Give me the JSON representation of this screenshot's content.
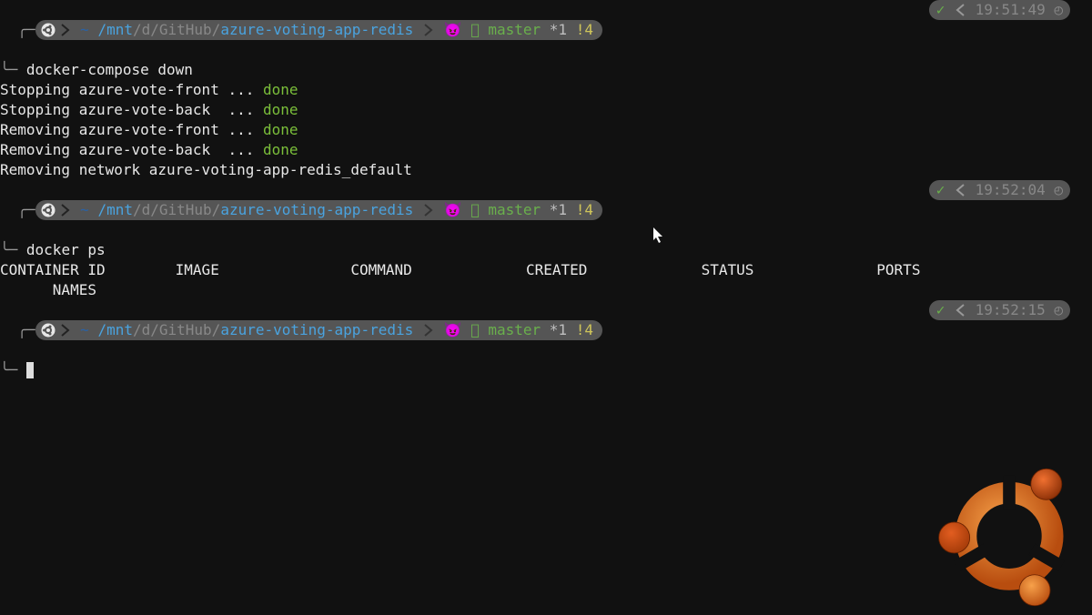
{
  "prompts": [
    {
      "path1": "/mnt",
      "path2": "/d/",
      "path3": "GitHub",
      "path4": "/",
      "repo": "azure-voting-app-redis",
      "branch": "master",
      "star": "*1",
      "bang": "!4",
      "time": "19:51:49",
      "command": "docker-compose down"
    },
    {
      "path1": "/mnt",
      "path2": "/d/",
      "path3": "GitHub",
      "path4": "/",
      "repo": "azure-voting-app-redis",
      "branch": "master",
      "star": "*1",
      "bang": "!4",
      "time": "19:52:04",
      "command": "docker ps"
    },
    {
      "path1": "/mnt",
      "path2": "/d/",
      "path3": "GitHub",
      "path4": "/",
      "repo": "azure-voting-app-redis",
      "branch": "master",
      "star": "*1",
      "bang": "!4",
      "time": "19:52:15",
      "command": ""
    }
  ],
  "branch_icon": "😈 ",
  "output1": [
    {
      "pre": "Stopping azure-vote-front ... ",
      "status": "done"
    },
    {
      "pre": "Stopping azure-vote-back  ... ",
      "status": "done"
    },
    {
      "pre": "Removing azure-vote-front ... ",
      "status": "done"
    },
    {
      "pre": "Removing azure-vote-back  ... ",
      "status": "done"
    },
    {
      "pre": "Removing network azure-voting-app-redis_default",
      "status": ""
    }
  ],
  "ps_header": "CONTAINER ID        IMAGE               COMMAND             CREATED             STATUS              PORTS         ",
  "ps_header2": "      NAMES",
  "tilde": "~ "
}
